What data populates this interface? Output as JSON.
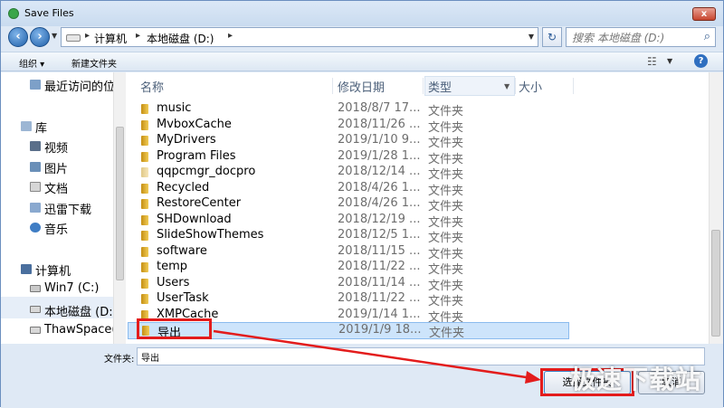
{
  "window": {
    "title": "Save Files",
    "close_label": "x"
  },
  "address": {
    "breadcrumbs": [
      "计算机",
      "本地磁盘 (D:)"
    ],
    "search_placeholder": "搜索 本地磁盘 (D:)"
  },
  "toolbar": {
    "organize_label": "组织 ▾",
    "new_folder_label": "新建文件夹"
  },
  "sidebar": {
    "items": [
      {
        "label": "最近访问的位",
        "icon": "recent-places-icon"
      },
      {
        "label": "库",
        "icon": "libraries-icon"
      },
      {
        "label": "视频",
        "icon": "video-icon"
      },
      {
        "label": "图片",
        "icon": "picture-icon"
      },
      {
        "label": "文档",
        "icon": "document-icon"
      },
      {
        "label": "迅雷下载",
        "icon": "download-icon"
      },
      {
        "label": "音乐",
        "icon": "music-icon"
      },
      {
        "label": "计算机",
        "icon": "computer-icon"
      },
      {
        "label": "Win7 (C:)",
        "icon": "drive-icon"
      },
      {
        "label": "本地磁盘 (D:",
        "icon": "drive-icon"
      },
      {
        "label": "ThawSpace(",
        "icon": "drive-icon"
      }
    ]
  },
  "columns": {
    "name": "名称",
    "date": "修改日期",
    "type": "类型",
    "size": "大小"
  },
  "files": [
    {
      "name": "music",
      "date": "2018/8/7 17...",
      "type": "文件夹"
    },
    {
      "name": "MvboxCache",
      "date": "2018/11/26 ...",
      "type": "文件夹"
    },
    {
      "name": "MyDrivers",
      "date": "2019/1/10 9...",
      "type": "文件夹"
    },
    {
      "name": "Program Files",
      "date": "2019/1/28 1...",
      "type": "文件夹"
    },
    {
      "name": "qqpcmgr_docpro",
      "date": "2018/12/14 ...",
      "type": "文件夹"
    },
    {
      "name": "Recycled",
      "date": "2018/4/26 1...",
      "type": "文件夹"
    },
    {
      "name": "RestoreCenter",
      "date": "2018/4/26 1...",
      "type": "文件夹"
    },
    {
      "name": "SHDownload",
      "date": "2018/12/19 ...",
      "type": "文件夹"
    },
    {
      "name": "SlideShowThemes",
      "date": "2018/12/5 1...",
      "type": "文件夹"
    },
    {
      "name": "software",
      "date": "2018/11/15 ...",
      "type": "文件夹"
    },
    {
      "name": "temp",
      "date": "2018/11/22 ...",
      "type": "文件夹"
    },
    {
      "name": "Users",
      "date": "2018/11/14 ...",
      "type": "文件夹"
    },
    {
      "name": "UserTask",
      "date": "2018/11/22 ...",
      "type": "文件夹"
    },
    {
      "name": "XMPCache",
      "date": "2019/1/14 1...",
      "type": "文件夹"
    },
    {
      "name": "导出",
      "date": "2019/1/9 18...",
      "type": "文件夹"
    }
  ],
  "footer": {
    "filename_label": "文件夹:",
    "filename_value": "导出",
    "save_label": "选择文件夹",
    "cancel_label": "取消"
  },
  "watermark": "极速下载站",
  "colors": {
    "accent": "#2f6fc0",
    "annotation": "#e31c1c",
    "selection": "#cde4fb"
  }
}
